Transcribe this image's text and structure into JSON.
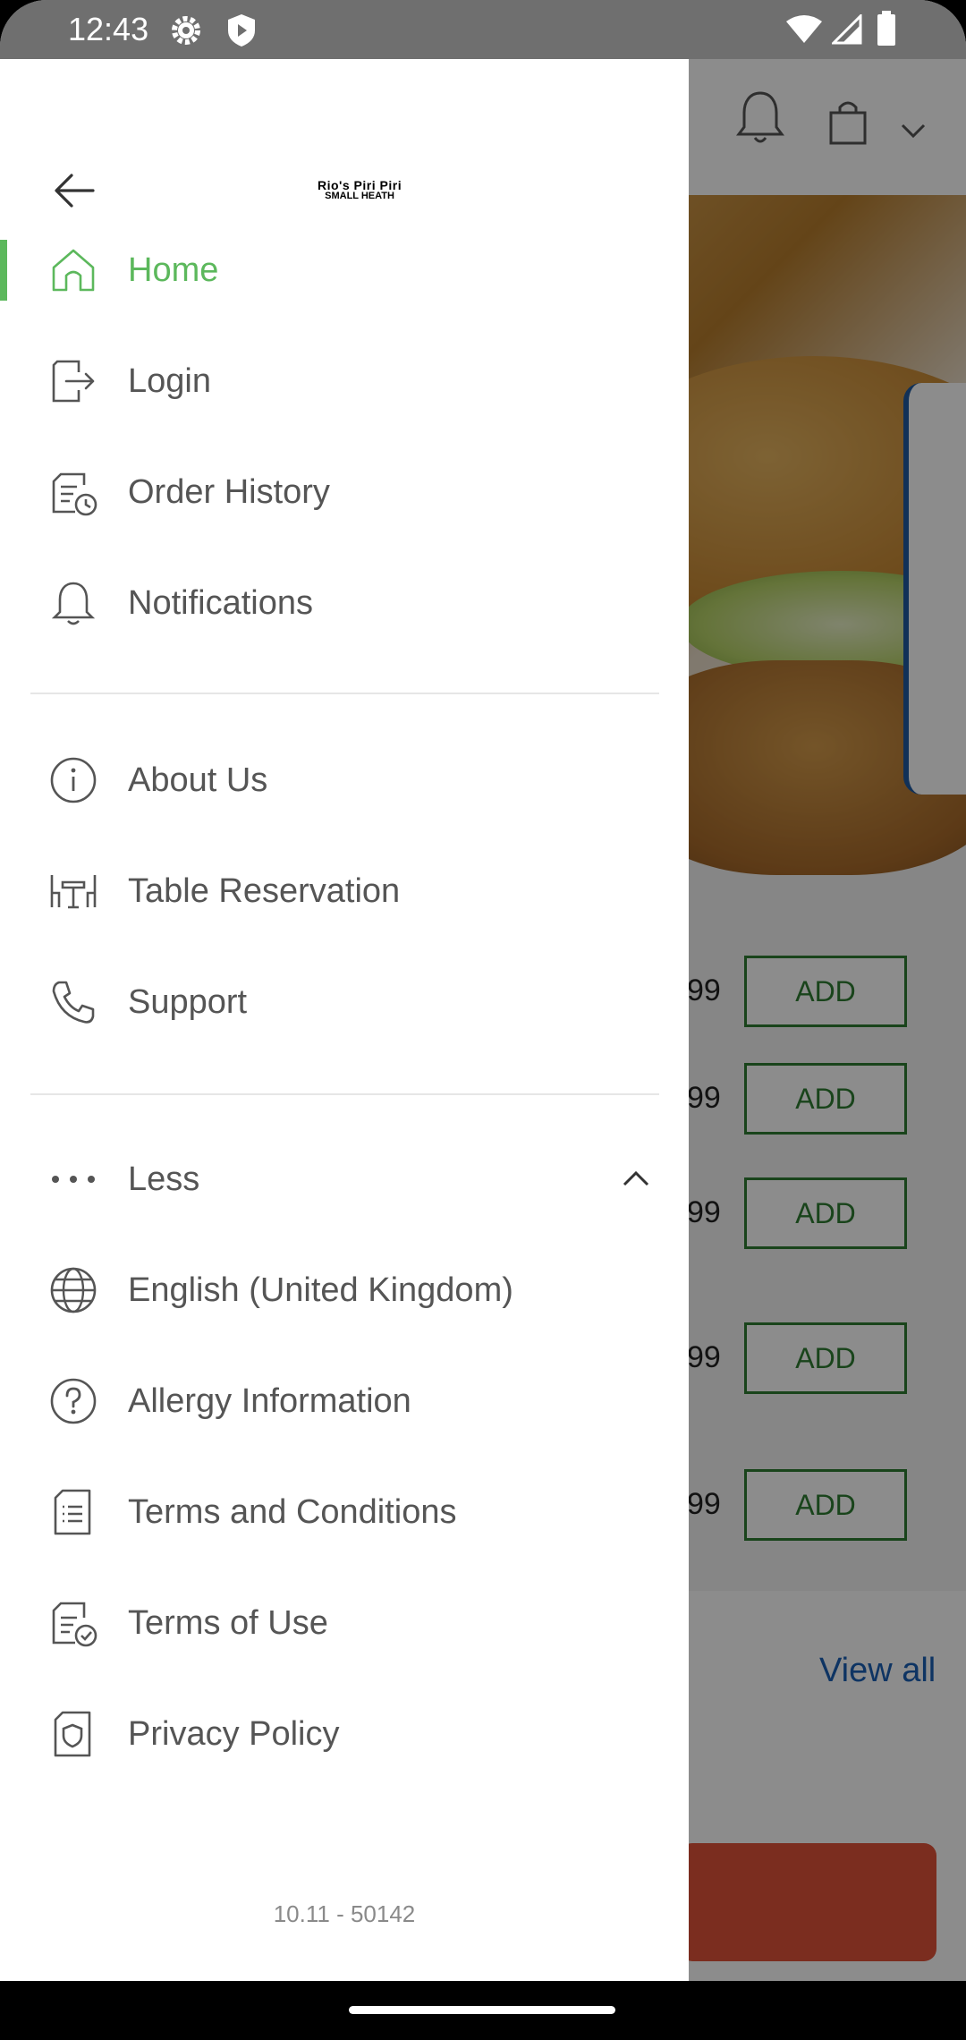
{
  "status_bar": {
    "time": "12:43",
    "icons": [
      "gear-icon",
      "shield-icon",
      "wifi-icon",
      "signal-icon",
      "battery-icon"
    ]
  },
  "drawer": {
    "logo": {
      "line1": "Rio's Piri Piri",
      "line2": "SMALL HEATH"
    },
    "items_primary": [
      {
        "label": "Home",
        "icon": "home-icon",
        "active": true
      },
      {
        "label": "Login",
        "icon": "login-icon"
      },
      {
        "label": "Order History",
        "icon": "order-history-icon"
      },
      {
        "label": "Notifications",
        "icon": "bell-icon"
      }
    ],
    "items_secondary": [
      {
        "label": "About Us",
        "icon": "info-icon"
      },
      {
        "label": "Table Reservation",
        "icon": "table-icon"
      },
      {
        "label": "Support",
        "icon": "phone-icon"
      }
    ],
    "less_label": "Less",
    "items_more": [
      {
        "label": "English (United Kingdom)",
        "icon": "globe-icon"
      },
      {
        "label": "Allergy Information",
        "icon": "question-icon"
      },
      {
        "label": "Terms and Conditions",
        "icon": "document-list-icon"
      },
      {
        "label": "Terms of Use",
        "icon": "document-check-icon"
      },
      {
        "label": "Privacy Policy",
        "icon": "privacy-shield-icon"
      }
    ],
    "version": "10.11 - 50142"
  },
  "background": {
    "prices": [
      "99",
      "99",
      "99",
      "99",
      "99"
    ],
    "add_label": "ADD",
    "view_all": "View all"
  },
  "colors": {
    "accent": "#5cb85c",
    "add_green": "#2e7d32",
    "link_blue": "#1a5fb4"
  }
}
